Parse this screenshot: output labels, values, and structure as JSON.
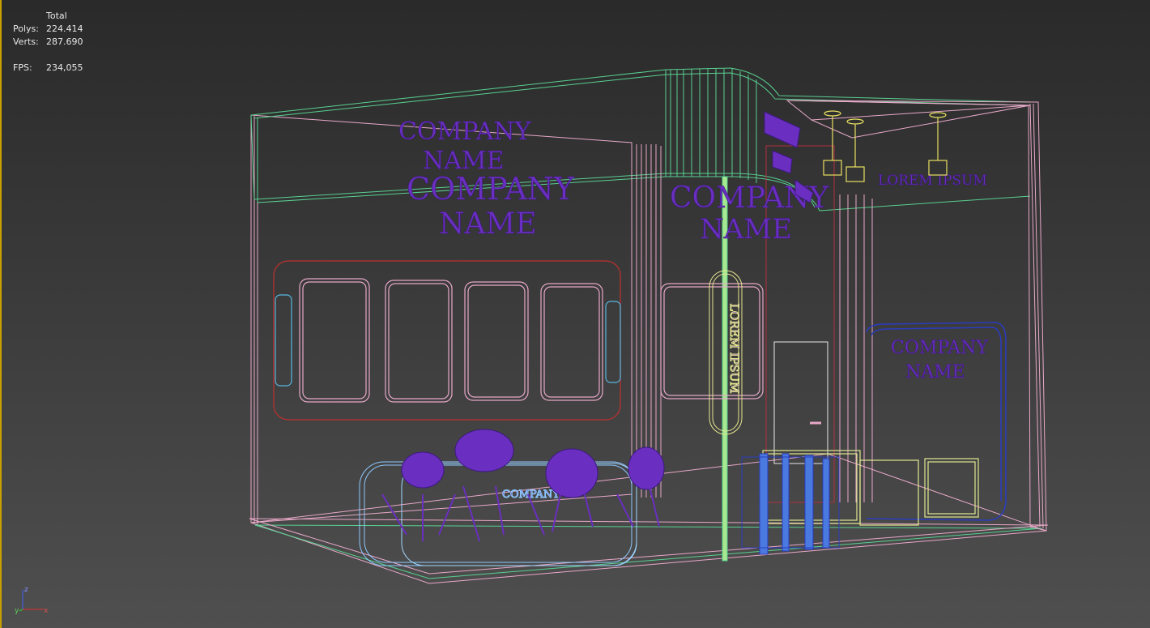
{
  "viewport": {
    "stats": {
      "header": "Total",
      "polys_label": "Polys:",
      "polys_value": "224.414",
      "verts_label": "Verts:",
      "verts_value": "287.690",
      "fps_label": "FPS:",
      "fps_value": "234,055"
    },
    "scene": {
      "header_logo_line1": "COMPANY",
      "header_logo_line2": "NAME",
      "wall_logo_line1": "COMPANY",
      "wall_logo_line2": "NAME",
      "center_logo_line1": "COMPANY",
      "center_logo_line2": "NAME",
      "right_header_text": "LOREM IPSUM",
      "desk_logo_line1": "COMPANY",
      "desk_logo_line2": "NAME",
      "panel_vertical_text": "LOREM IPSUM",
      "counter_text": "COMPANY"
    },
    "axis": {
      "z": "z",
      "y": "y",
      "x": "x"
    },
    "colors": {
      "wire_pink": "#e8a8c8",
      "wire_green": "#58d090",
      "wire_red": "#c03030",
      "wire_purple": "#6a2fc0",
      "wire_blue": "#2a3cc0",
      "wire_lightblue": "#8ec8ff",
      "wire_yellow": "#e0e890",
      "accent_border": "#c8a000"
    }
  }
}
